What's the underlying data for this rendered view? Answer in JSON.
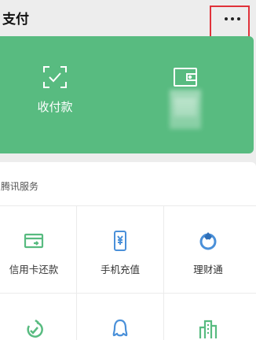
{
  "header": {
    "title": "支付"
  },
  "green_card": {
    "receive_pay_label": "收付款",
    "accent": "#58bb80"
  },
  "services": {
    "section_title": "腾讯服务",
    "row1": [
      {
        "label": "信用卡还款",
        "icon": "credit-card-icon"
      },
      {
        "label": "手机充值",
        "icon": "phone-topup-icon"
      },
      {
        "label": "理财通",
        "icon": "wealth-icon"
      }
    ],
    "row2": [
      {
        "label": "",
        "icon": "leaf-check-icon"
      },
      {
        "label": "",
        "icon": "qq-penguin-icon"
      },
      {
        "label": "",
        "icon": "city-buildings-icon"
      }
    ]
  },
  "highlight_color": "#e0323a"
}
